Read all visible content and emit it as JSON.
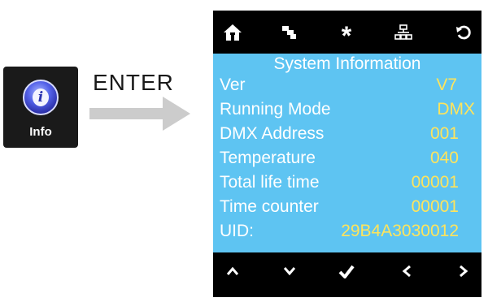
{
  "info_icon": {
    "glyph": "i",
    "label": "Info"
  },
  "enter": {
    "label": "ENTER"
  },
  "toolbar": {
    "icons": [
      "home-icon",
      "layers-icon",
      "asterisk-icon",
      "network-icon",
      "refresh-icon"
    ],
    "asterisk": "*"
  },
  "system": {
    "title": "System Information",
    "rows": [
      {
        "label": "Ver",
        "value": "V7"
      },
      {
        "label": "Running Mode",
        "value": "DMX"
      },
      {
        "label": "DMX Address",
        "value": "001"
      },
      {
        "label": "Temperature",
        "value": "040"
      },
      {
        "label": "Total life time",
        "value": "00001"
      },
      {
        "label": "Time counter",
        "value": "00001"
      },
      {
        "label": "UID:",
        "value": "29B4A3030012"
      }
    ]
  },
  "navbar": {
    "up": "^",
    "down": "v",
    "confirm": "✔",
    "left": "<",
    "right": ">"
  },
  "colors": {
    "panel": "#5ec4f2",
    "value": "#ffe45c",
    "screen_bg": "#000000",
    "arrow": "#cccccc"
  }
}
